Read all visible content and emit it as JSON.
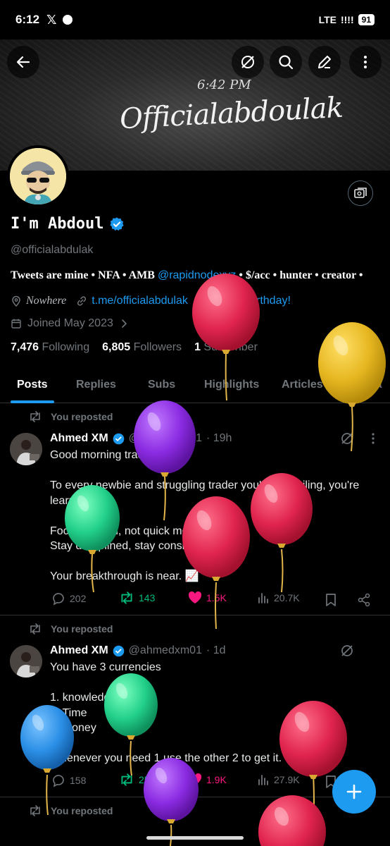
{
  "status": {
    "time": "6:12",
    "x_logo": "𝕏",
    "network": "LTE",
    "signal": "!!!!",
    "battery": "91"
  },
  "banner": {
    "time_text": "6:42 PM",
    "signature": "Officialabdoulak"
  },
  "profile": {
    "display_name": "I'm Abdoul",
    "handle": "@officialabdulak",
    "bio_prefix": "Tweets are mine • NFA • AMB ",
    "bio_mention": "@rapidnodexyz",
    "bio_suffix": " • $/acc • hunter • creator •",
    "location": "Nowhere",
    "link": "t.me/officialabdulak",
    "birthday": "Happy birthday!",
    "joined": "Joined May 2023",
    "following_count": "7,476",
    "following_label": "Following",
    "followers_count": "6,805",
    "followers_label": "Followers",
    "subscriber_count": "1",
    "subscriber_label": "Subscriber"
  },
  "tabs": [
    "Posts",
    "Replies",
    "Subs",
    "Highlights",
    "Articles",
    "Media"
  ],
  "posts": [
    {
      "repost_label": "You reposted",
      "author": "Ahmed XM",
      "handle": "@ahmedxm01",
      "time": "· 19h",
      "lines": [
        "Good morning traders ☀️",
        "",
        "To every newbie and struggling trader you're not failing, you're",
        "learning.",
        "",
        "Focus on skill, not quick money.",
        "Stay disciplined, stay consistent.",
        "",
        "Your breakthrough is near. 📈"
      ],
      "replies": "202",
      "reposts": "143",
      "likes": "1.5K",
      "views": "20.7K"
    },
    {
      "repost_label": "You reposted",
      "author": "Ahmed XM",
      "handle": "@ahmedxm01",
      "time": "· 1d",
      "lines": [
        "You have 3 currencies",
        "",
        "1. knowledge",
        "2. Time",
        "3. Money",
        "",
        "Whenever you need 1 use the other 2 to get it."
      ],
      "replies": "158",
      "reposts": "259",
      "likes": "1.9K",
      "views": "27.9K"
    },
    {
      "repost_label": "You reposted"
    }
  ],
  "colors": {
    "accent": "#1d9bf0",
    "like": "#f91880",
    "repost": "#00ba7c",
    "muted": "#71767b"
  },
  "icons": [
    "back-arrow-icon",
    "grok-icon",
    "search-icon",
    "edit-icon",
    "more-vertical-icon",
    "photo-icon",
    "verified-badge-icon",
    "location-icon",
    "link-icon",
    "balloon-icon",
    "calendar-icon",
    "chevron-right-icon",
    "repost-icon",
    "reply-icon",
    "like-icon",
    "views-icon",
    "bookmark-icon",
    "share-icon",
    "plus-icon"
  ]
}
